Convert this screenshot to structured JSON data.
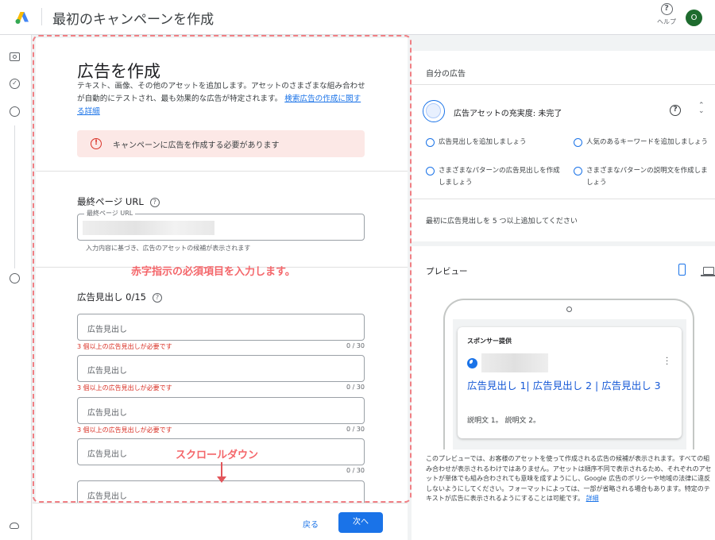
{
  "app": {
    "title": "最初のキャンペーンを作成",
    "help_label": "ヘルプ",
    "avatar_initial": "O",
    "brand_colors": {
      "blue": "#4285F4",
      "yellow": "#FBBC04",
      "green": "#34A853"
    }
  },
  "form": {
    "heading": "広告を作成",
    "description": "テキスト、画像、その他のアセットを追加します。アセットのさまざまな組み合わせが自動的にテストされ、最も効果的な広告が特定されます。",
    "description_link": "検索広告の作成に関する詳細",
    "error_message": "キャンペーンに広告を作成する必要があります",
    "final_url_label": "最終ページ URL",
    "final_url_field_label": "最終ページ URL",
    "final_url_helper": "入力内容に基づき、広告のアセットの候補が表示されます",
    "headlines_label": "広告見出し 0/15",
    "headlines": [
      {
        "placeholder": "広告見出し",
        "error": "3 個以上の広告見出しが必要です",
        "count": "0 / 30"
      },
      {
        "placeholder": "広告見出し",
        "error": "3 個以上の広告見出しが必要です",
        "count": "0 / 30"
      },
      {
        "placeholder": "広告見出し",
        "error": "3 個以上の広告見出しが必要です",
        "count": "0 / 30"
      },
      {
        "placeholder": "広告見出し",
        "error": "",
        "count": "0 / 30"
      },
      {
        "placeholder": "広告見出し",
        "error": "",
        "count": ""
      }
    ],
    "back_label": "戻る",
    "next_label": "次へ"
  },
  "annotations": {
    "required_note": "赤字指示の必須項目を入力します。",
    "scroll_note": "スクロールダウン",
    "color": "#f4666a"
  },
  "side": {
    "title": "自分の広告",
    "strength": "広告アセットの充実度: 未完了",
    "suggestions": [
      "広告見出しを追加しましょう",
      "人気のあるキーワードを追加しましょう",
      "さまざまなパターンの広告見出しを作成しましょう",
      "さまざまなパターンの説明文を作成しましょう"
    ],
    "min_note": "最初に広告見出しを 5 つ以上追加してください",
    "preview_title": "プレビュー",
    "ad_sponsor": "スポンサー提供",
    "ad_headline": "広告見出し 1| 広告見出し 2 | 広告見出し 3",
    "ad_description": "説明文 1。 説明文 2。",
    "disclaimer": "このプレビューでは、お客様のアセットを使って作成される広告の候補が表示されます。すべての組み合わせが表示されるわけではありません。アセットは順序不同で表示されるため、それぞれのアセットが単体でも組み合わされても意味を成すようにし、Google 広告のポリシーや地域の法律に違反しないようにしてください。フォーマットによっては、一部が省略される場合もあります。特定のテキストが広告に表示されるようにすることは可能です。",
    "disclaimer_link": "詳細"
  }
}
